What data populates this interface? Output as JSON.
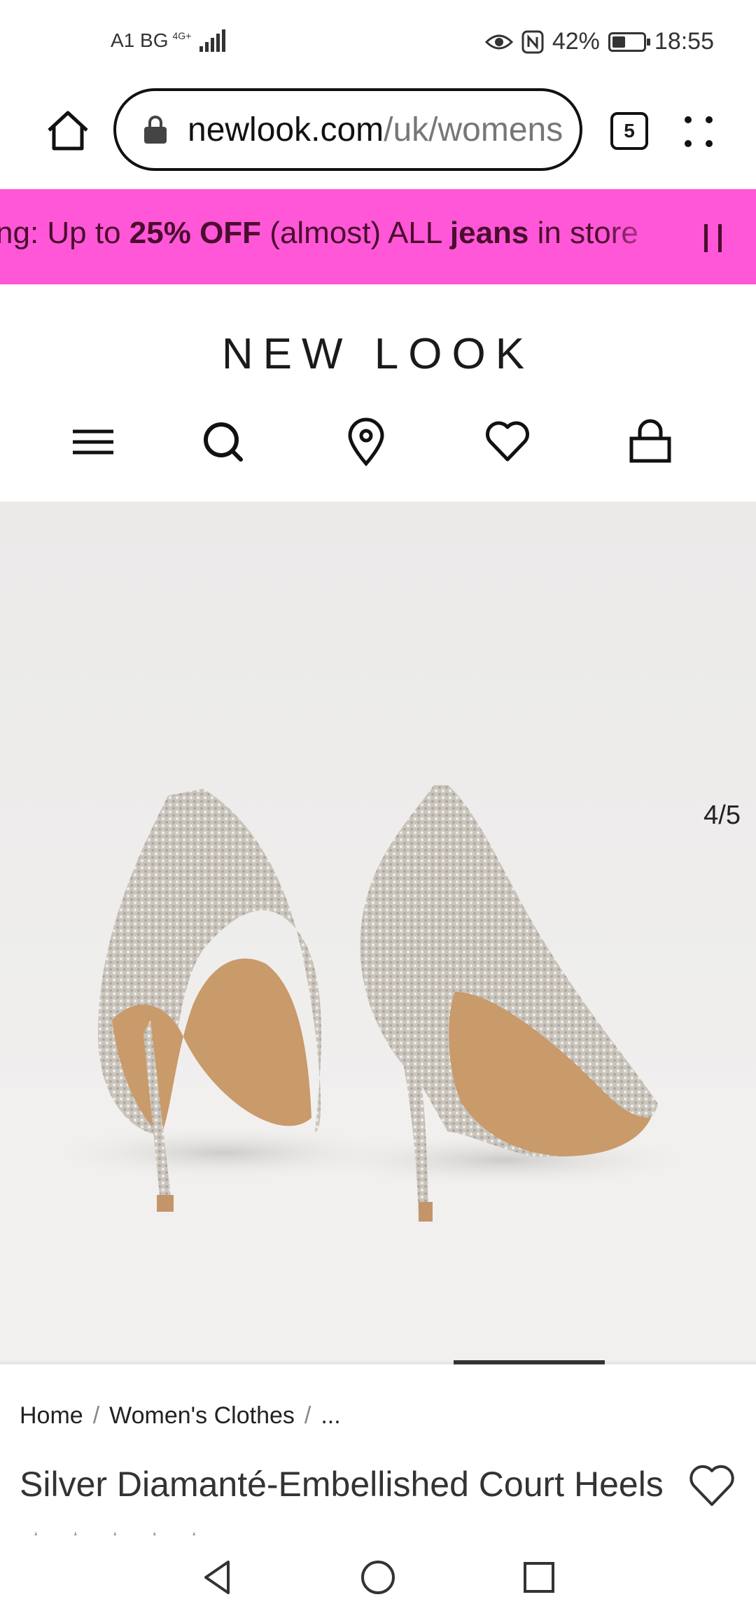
{
  "status_bar": {
    "carrier": "A1 BG",
    "network": "4G+",
    "battery": "42%",
    "battery_level": 0.42,
    "time": "18:55"
  },
  "browser": {
    "url_domain": "newlook.com",
    "url_path": "/uk/womens",
    "tab_count": "5"
  },
  "promo": {
    "text_prefix": "ng: Up to ",
    "text_bold1": "25% OFF",
    "text_mid": " (almost) ALL ",
    "text_bold2": "jeans",
    "text_suffix": " in store"
  },
  "logo": "NEW LOOK",
  "product": {
    "image_counter": "4/5",
    "breadcrumb": [
      "Home",
      "Women's Clothes",
      "..."
    ],
    "title": "Silver Diamanté-Embellished Court Heels"
  },
  "icons": {
    "home": "home-icon",
    "lock": "lock-icon",
    "menu": "more-icon",
    "pause": "pause-icon",
    "hamburger": "hamburger-menu-icon",
    "search": "search-icon",
    "store": "location-pin-icon",
    "wishlist": "heart-icon",
    "bag": "shopping-bag-icon"
  },
  "colors": {
    "promo_bg": "#ff57d7",
    "promo_text": "#4a0d2e"
  }
}
